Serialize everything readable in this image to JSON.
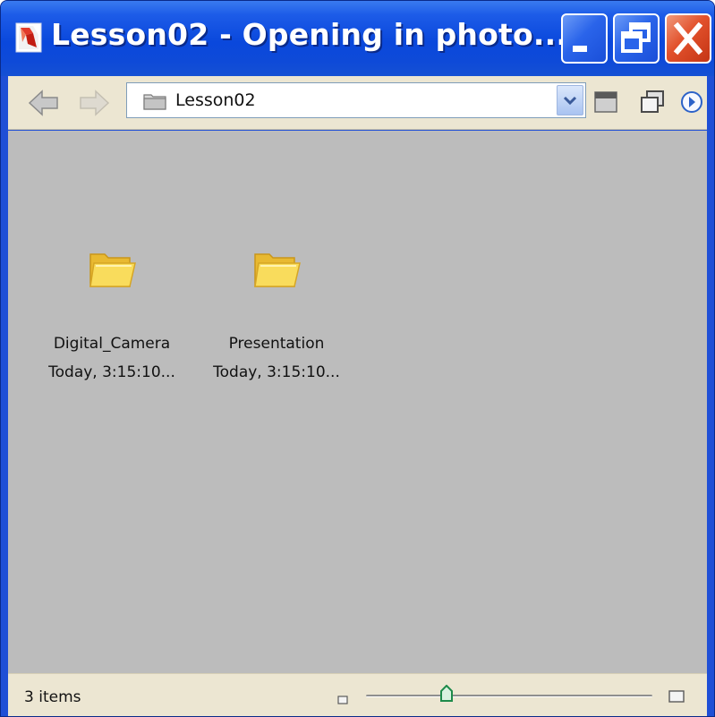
{
  "window": {
    "title": "Lesson02 - Opening in photo...",
    "app_icon": "adobe-bridge-icon",
    "controls": [
      "minimize-icon",
      "restore-icon",
      "close-icon"
    ]
  },
  "toolbar": {
    "back_icon": "back-arrow-icon",
    "forward_icon": "forward-arrow-icon",
    "address": {
      "icon": "folder-icon",
      "value": "Lesson02",
      "dropdown_icon": "chevron-down-icon"
    },
    "right_icons": [
      "compact-mode-icon",
      "switch-window-icon",
      "menu-arrow-icon"
    ]
  },
  "content": {
    "items": [
      {
        "icon": "folder-icon",
        "name": "Digital_Camera",
        "date": "Today, 3:15:10..."
      },
      {
        "icon": "folder-icon",
        "name": "Presentation",
        "date": "Today, 3:15:10..."
      }
    ]
  },
  "statusbar": {
    "count": "3 items",
    "zoom_level": 0.28
  },
  "colors": {
    "title_bar": "#0a48dc",
    "toolbar_bg": "#ece6d2",
    "content_bg": "#bcbcbc",
    "close_button": "#e2512c",
    "folder": "#f7d44c"
  }
}
